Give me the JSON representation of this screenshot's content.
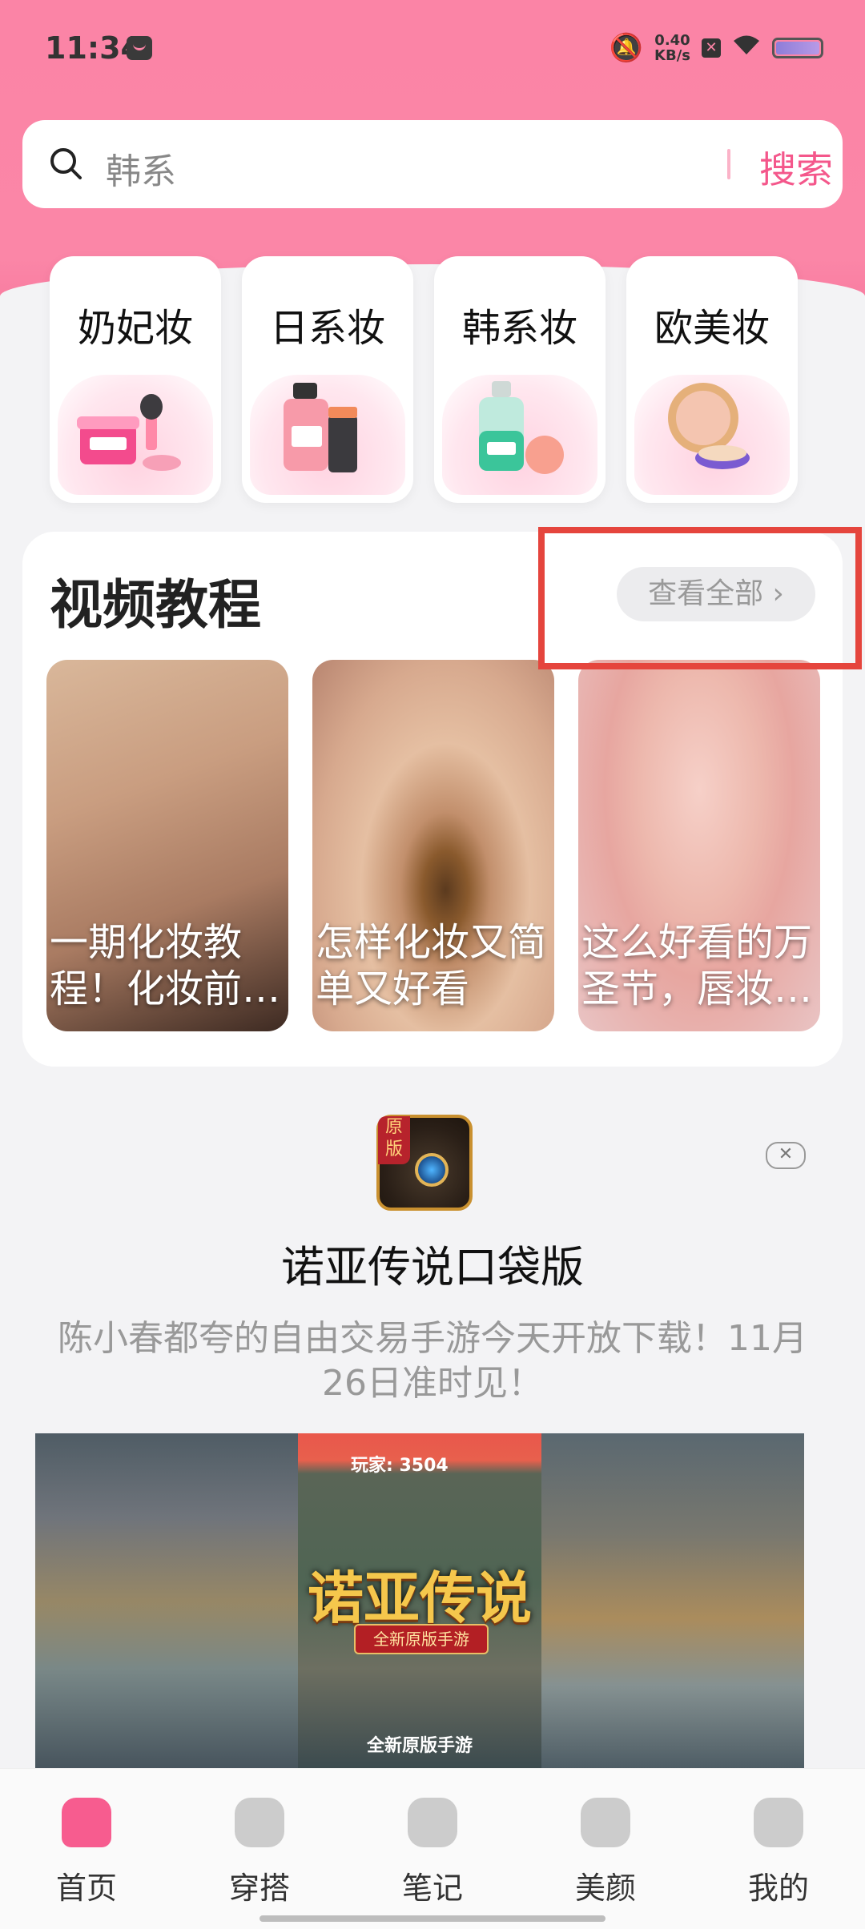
{
  "status_bar": {
    "time": "11:34",
    "net_speed_value": "0.40",
    "net_speed_unit": "KB/s"
  },
  "search": {
    "placeholder": "韩系",
    "button": "搜索"
  },
  "categories": [
    {
      "label": "奶妃妆"
    },
    {
      "label": "日系妆"
    },
    {
      "label": "韩系妆"
    },
    {
      "label": "欧美妆"
    }
  ],
  "video_section": {
    "title": "视频教程",
    "view_all": "查看全部 ›",
    "videos": [
      {
        "caption": "一期化妆教程！化妆前…"
      },
      {
        "caption": "怎样化妆又简单又好看"
      },
      {
        "caption": "这么好看的万圣节，唇妆…"
      }
    ]
  },
  "ad": {
    "close": "✕",
    "logo_badge": "原版",
    "title": "诺亚传说口袋版",
    "description": "陈小春都夸的自由交易手游今天开放下载！11月26日准时见！",
    "media": {
      "score": "玩家: 3504",
      "game_title": "诺亚传说",
      "tagline": "全新原版手游",
      "footer": "全新原版手游"
    }
  },
  "bottom_nav": [
    {
      "label": "首页",
      "icon": "home-icon",
      "active": true
    },
    {
      "label": "穿搭",
      "icon": "clothes-icon"
    },
    {
      "label": "笔记",
      "icon": "star-note-icon"
    },
    {
      "label": "美颜",
      "icon": "makeup-brush-icon"
    },
    {
      "label": "我的",
      "icon": "profile-icon"
    }
  ],
  "colors": {
    "brand_pink": "#fb84a6",
    "accent": "#f4578b",
    "highlight_box": "#e5453d"
  }
}
